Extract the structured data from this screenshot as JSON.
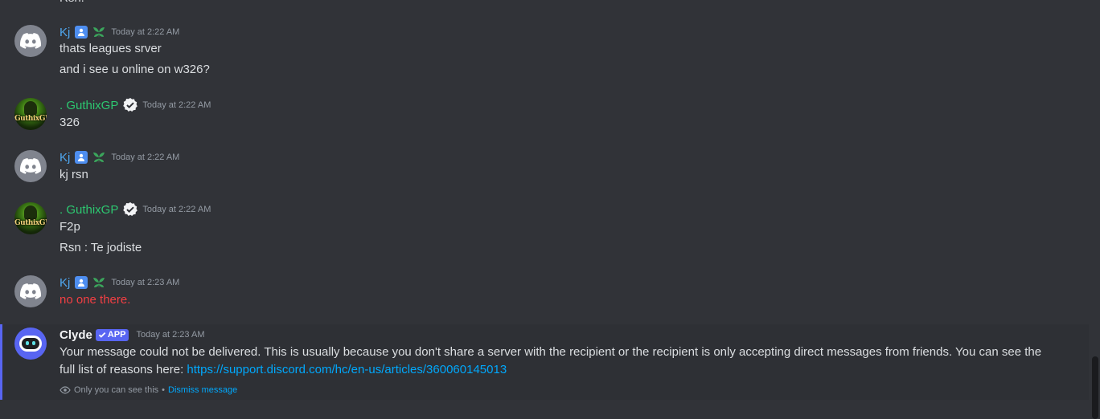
{
  "top_partial_text": "Rsn.",
  "messages": [
    {
      "author": "Kj",
      "timestamp": "Today at 2:22 AM",
      "lines": [
        "thats leagues srver",
        "and i see u online on w326?"
      ]
    },
    {
      "author": ". GuthixGP",
      "timestamp": "Today at 2:22 AM",
      "avatar_text": "GuthixGP",
      "lines": [
        "326"
      ]
    },
    {
      "author": "Kj",
      "timestamp": "Today at 2:22 AM",
      "lines": [
        "kj rsn"
      ]
    },
    {
      "author": ". GuthixGP",
      "timestamp": "Today at 2:22 AM",
      "avatar_text": "GuthixGP",
      "lines": [
        "F2p",
        "Rsn : Te jodiste"
      ]
    },
    {
      "author": "Kj",
      "timestamp": "Today at 2:23 AM",
      "lines": [
        "no one there."
      ]
    }
  ],
  "clyde": {
    "author": "Clyde",
    "tag": "APP",
    "timestamp": "Today at 2:23 AM",
    "text_before_link": "Your message could not be delivered. This is usually because you don't share a server with the recipient or the recipient is only accepting direct messages from friends. You can see the full list of reasons here: ",
    "link": "https://support.discord.com/hc/en-us/articles/360060145013",
    "ephemeral_note": "Only you can see this",
    "separator": "•",
    "dismiss_label": "Dismiss message"
  },
  "colors": {
    "background": "#313338",
    "kj_name": "#4ea6ef",
    "guthix_name": "#2dc770",
    "error_text": "#f23f43",
    "link": "#00a8fc",
    "clyde_accent": "#5865f2"
  }
}
